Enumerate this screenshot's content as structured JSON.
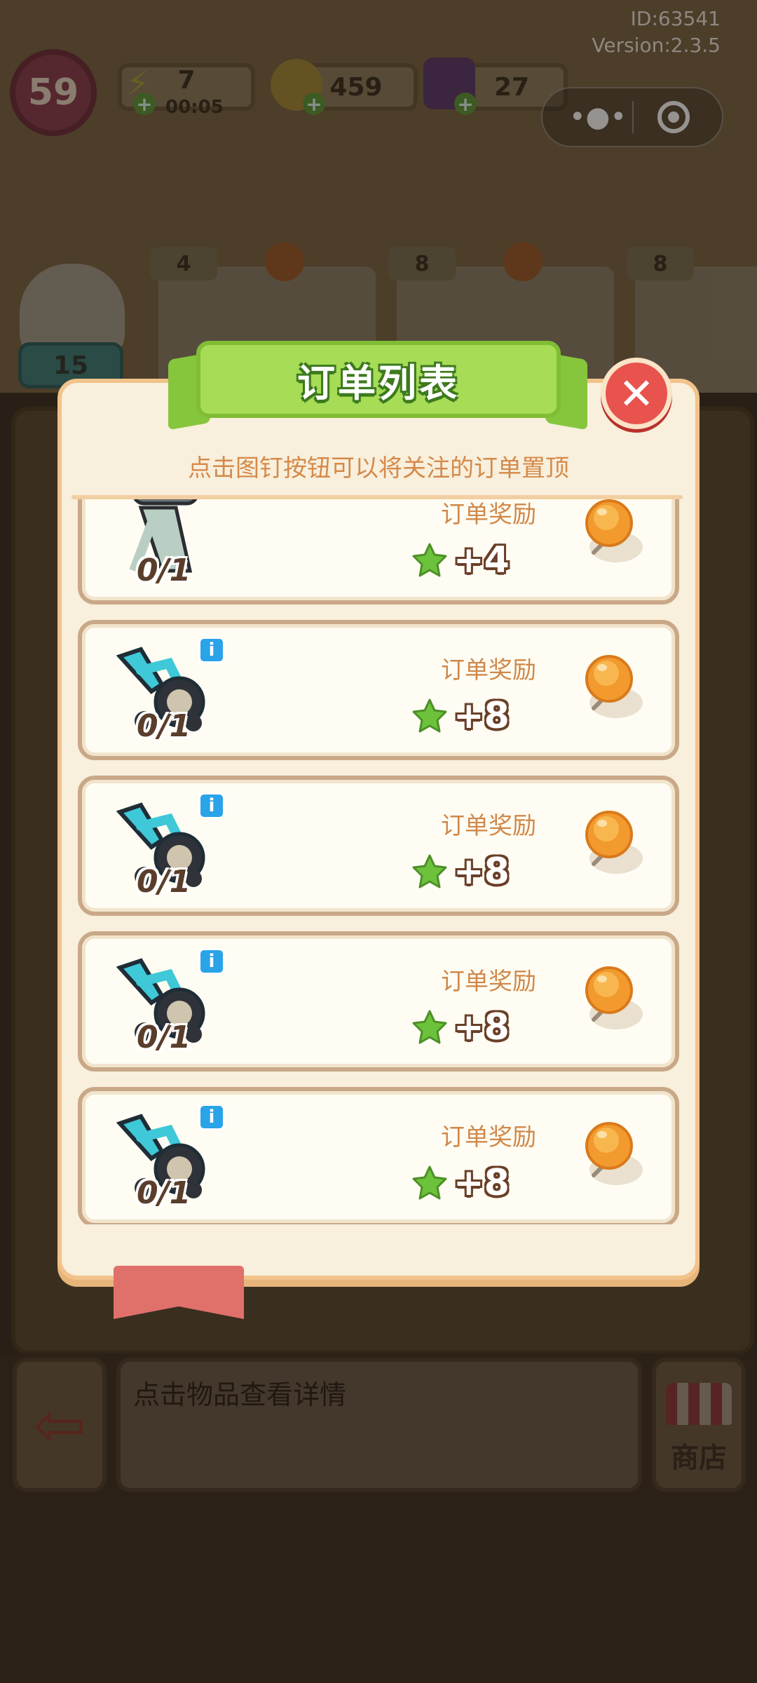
{
  "app": {
    "id_text": "ID:63541",
    "version_text": "Version:2.3.5"
  },
  "hud": {
    "level": "59",
    "energy": "7",
    "energy_timer": "00:05",
    "coins": "459",
    "gems": "27",
    "more_menu_icon": "more-dots-icon",
    "close_miniapp_icon": "target-circle-icon"
  },
  "background": {
    "order_stars": [
      "4",
      "8",
      "8"
    ],
    "chick_count": "15"
  },
  "modal": {
    "title": "订单列表",
    "subtitle": "点击图钉按钮可以将关注的订单置顶",
    "close_icon": "close-x-icon",
    "orders": [
      {
        "progress": "0/1",
        "reward_label": "订单奖励",
        "reward": "+4",
        "item": "weight-bench",
        "pinned": false
      },
      {
        "progress": "0/1",
        "reward_label": "订单奖励",
        "reward": "+8",
        "item": "exercise-bike",
        "pinned": false
      },
      {
        "progress": "0/1",
        "reward_label": "订单奖励",
        "reward": "+8",
        "item": "exercise-bike",
        "pinned": false
      },
      {
        "progress": "0/1",
        "reward_label": "订单奖励",
        "reward": "+8",
        "item": "exercise-bike",
        "pinned": false
      },
      {
        "progress": "0/1",
        "reward_label": "订单奖励",
        "reward": "+8",
        "item": "exercise-bike",
        "pinned": false
      }
    ]
  },
  "bottom": {
    "info_placeholder": "点击物品查看详情",
    "shop_label": "商店"
  },
  "colors": {
    "modal_bg": "#f8efdc",
    "title_green": "#a6dc56",
    "close_red": "#e8534e",
    "reward_label": "#d0884a",
    "star_green": "#6cc23a",
    "pin_orange": "#f29a2e"
  }
}
